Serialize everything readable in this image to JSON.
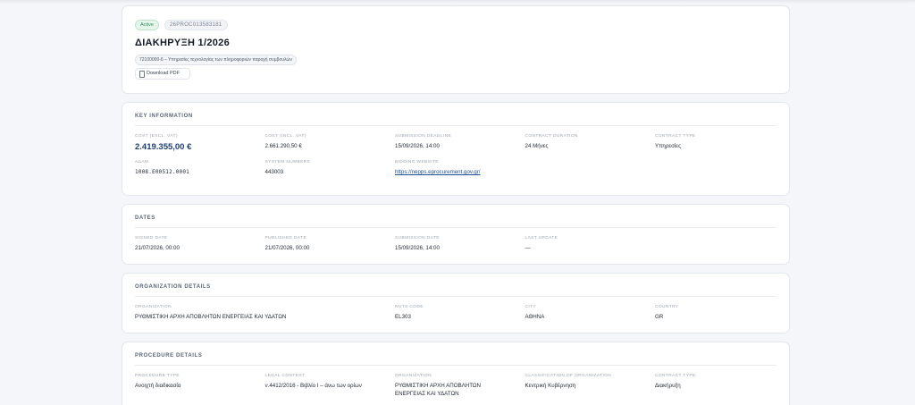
{
  "header": {
    "status": "Active",
    "reference": "26PROC013583181",
    "title": "ΔΙΑΚΗΡΥΞΗ 1/2026",
    "cpv": "72100000-6 – Υπηρεσίες τεχνολογίας των πληροφοριών παροχή συμβουλών",
    "download_label": "Download PDF"
  },
  "key_information": {
    "title": "KEY INFORMATION",
    "fields": [
      {
        "label": "COST (EXCL. VAT)",
        "value": "2.419.355,00 €"
      },
      {
        "label": "COST (INCL. VAT)",
        "value": "2.661.290,50 €"
      },
      {
        "label": "SUBMISSION DEADLINE",
        "value": "15/09/2026, 14:00"
      },
      {
        "label": "CONTRACT DURATION",
        "value": "24 Μήνες"
      },
      {
        "label": "CONTRACT TYPE",
        "value": "Υπηρεσίες"
      },
      {
        "label": "ΑΔΑΜ",
        "value": "1008.Ε00512.0001"
      },
      {
        "label": "SYSTEM NUMBERS",
        "value": "443003"
      },
      {
        "label": "BIDDING WEBSITE",
        "value": "https://nepps.eprocurement.gov.gr/"
      }
    ]
  },
  "dates": {
    "title": "DATES",
    "fields": [
      {
        "label": "SIGNED DATE",
        "value": "21/07/2026, 00:00"
      },
      {
        "label": "PUBLISHED DATE",
        "value": "21/07/2026, 00:00"
      },
      {
        "label": "SUBMISSION DATE",
        "value": "15/09/2026, 14:00"
      },
      {
        "label": "LAST UPDATE",
        "value": "—"
      }
    ]
  },
  "organization": {
    "title": "ORGANIZATION DETAILS",
    "fields": [
      {
        "label": "ORGANIZATION",
        "value": "ΡΥΘΜΙΣΤΙΚΗ ΑΡΧΗ ΑΠΟΒΛΗΤΩΝ ΕΝΕΡΓΕΙΑΣ ΚΑΙ ΥΔΑΤΩΝ"
      },
      {
        "label": "NUTS CODE",
        "value": "EL303"
      },
      {
        "label": "CITY",
        "value": "ΑΘΗΝΑ"
      },
      {
        "label": "COUNTRY",
        "value": "GR"
      }
    ]
  },
  "procedure": {
    "title": "PROCEDURE DETAILS",
    "fields": [
      {
        "label": "PROCEDURE TYPE",
        "value": "Ανοιχτή διαδικασία"
      },
      {
        "label": "LEGAL CONTEXT",
        "value": "ν.4412/2016 - Βιβλίο I – άνω των ορίων"
      },
      {
        "label": "ORGANIZATION",
        "value": "ΡΥΘΜΙΣΤΙΚΗ ΑΡΧΗ ΑΠΟΒΛΗΤΩΝ ΕΝΕΡΓΕΙΑΣ ΚΑΙ ΥΔΑΤΩΝ"
      },
      {
        "label": "CLASSIFICATION OF ORGANIZATION",
        "value": "Κεντρική Κυβέρνηση"
      },
      {
        "label": "CONTRACT TYPE",
        "value": "Διακήρυξη"
      }
    ]
  }
}
